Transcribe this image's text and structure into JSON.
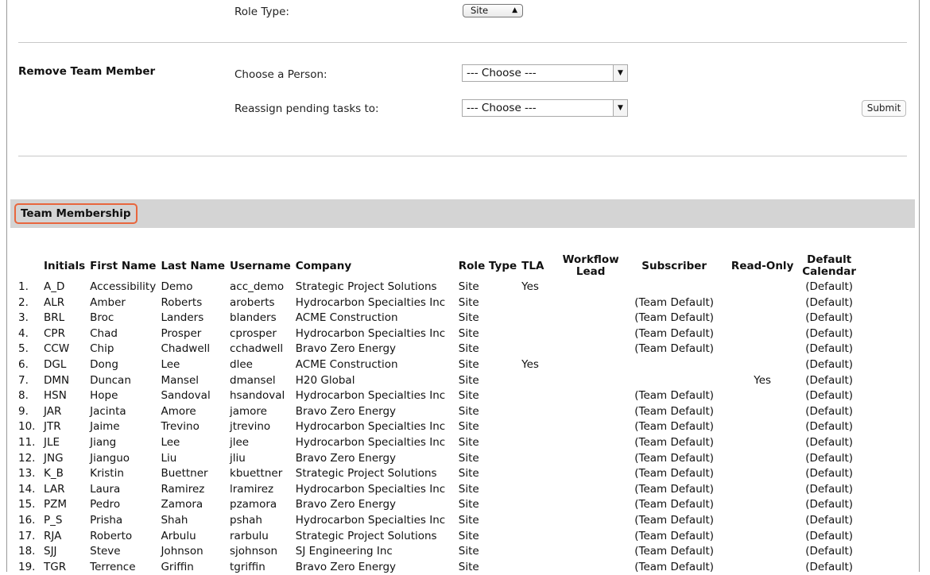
{
  "role_type": {
    "label": "Role Type:",
    "selected": "Site"
  },
  "remove_member": {
    "title": "Remove Team Member",
    "person_label": "Choose a Person:",
    "person_value": "--- Choose ---",
    "reassign_label": "Reassign pending tasks to:",
    "reassign_value": "--- Choose ---",
    "submit_label": "Submit"
  },
  "membership": {
    "title": "Team Membership",
    "columns": [
      "",
      "Initials",
      "First Name",
      "Last Name",
      "Username",
      "Company",
      "Role Type",
      "TLA",
      "Workflow Lead",
      "Subscriber",
      "Read-Only",
      "Default Calendar"
    ],
    "rows": [
      [
        "1.",
        "A_D",
        "Accessibility",
        "Demo",
        "acc_demo",
        "Strategic Project Solutions",
        "Site",
        "Yes",
        "",
        "",
        "",
        "(Default)"
      ],
      [
        "2.",
        "ALR",
        "Amber",
        "Roberts",
        "aroberts",
        "Hydrocarbon Specialties Inc",
        "Site",
        "",
        "",
        "(Team Default)",
        "",
        "(Default)"
      ],
      [
        "3.",
        "BRL",
        "Broc",
        "Landers",
        "blanders",
        "ACME Construction",
        "Site",
        "",
        "",
        "(Team Default)",
        "",
        "(Default)"
      ],
      [
        "4.",
        "CPR",
        "Chad",
        "Prosper",
        "cprosper",
        "Hydrocarbon Specialties Inc",
        "Site",
        "",
        "",
        "(Team Default)",
        "",
        "(Default)"
      ],
      [
        "5.",
        "CCW",
        "Chip",
        "Chadwell",
        "cchadwell",
        "Bravo Zero Energy",
        "Site",
        "",
        "",
        "(Team Default)",
        "",
        "(Default)"
      ],
      [
        "6.",
        "DGL",
        "Dong",
        "Lee",
        "dlee",
        "ACME Construction",
        "Site",
        "Yes",
        "",
        "",
        "",
        "(Default)"
      ],
      [
        "7.",
        "DMN",
        "Duncan",
        "Mansel",
        "dmansel",
        "H20 Global",
        "Site",
        "",
        "",
        "",
        "Yes",
        "(Default)"
      ],
      [
        "8.",
        "HSN",
        "Hope",
        "Sandoval",
        "hsandoval",
        "Hydrocarbon Specialties Inc",
        "Site",
        "",
        "",
        "(Team Default)",
        "",
        "(Default)"
      ],
      [
        "9.",
        "JAR",
        "Jacinta",
        "Amore",
        "jamore",
        "Bravo Zero Energy",
        "Site",
        "",
        "",
        "(Team Default)",
        "",
        "(Default)"
      ],
      [
        "10.",
        "JTR",
        "Jaime",
        "Trevino",
        "jtrevino",
        "Hydrocarbon Specialties Inc",
        "Site",
        "",
        "",
        "(Team Default)",
        "",
        "(Default)"
      ],
      [
        "11.",
        "JLE",
        "Jiang",
        "Lee",
        "jlee",
        "Hydrocarbon Specialties Inc",
        "Site",
        "",
        "",
        "(Team Default)",
        "",
        "(Default)"
      ],
      [
        "12.",
        "JNG",
        "Jianguo",
        "Liu",
        "jliu",
        "Bravo Zero Energy",
        "Site",
        "",
        "",
        "(Team Default)",
        "",
        "(Default)"
      ],
      [
        "13.",
        "K_B",
        "Kristin",
        "Buettner",
        "kbuettner",
        "Strategic Project Solutions",
        "Site",
        "",
        "",
        "(Team Default)",
        "",
        "(Default)"
      ],
      [
        "14.",
        "LAR",
        "Laura",
        "Ramirez",
        "lramirez",
        "Hydrocarbon Specialties Inc",
        "Site",
        "",
        "",
        "(Team Default)",
        "",
        "(Default)"
      ],
      [
        "15.",
        "PZM",
        "Pedro",
        "Zamora",
        "pzamora",
        "Bravo Zero Energy",
        "Site",
        "",
        "",
        "(Team Default)",
        "",
        "(Default)"
      ],
      [
        "16.",
        "P_S",
        "Prisha",
        "Shah",
        "pshah",
        "Hydrocarbon Specialties Inc",
        "Site",
        "",
        "",
        "(Team Default)",
        "",
        "(Default)"
      ],
      [
        "17.",
        "RJA",
        "Roberto",
        "Arbulu",
        "rarbulu",
        "Strategic Project Solutions",
        "Site",
        "",
        "",
        "(Team Default)",
        "",
        "(Default)"
      ],
      [
        "18.",
        "SJJ",
        "Steve",
        "Johnson",
        "sjohnson",
        "SJ Engineering Inc",
        "Site",
        "",
        "",
        "(Team Default)",
        "",
        "(Default)"
      ],
      [
        "19.",
        "TGR",
        "Terrence",
        "Griffin",
        "tgriffin",
        "Bravo Zero Energy",
        "Site",
        "",
        "",
        "(Team Default)",
        "",
        "(Default)"
      ]
    ]
  },
  "colors": {
    "highlight": "#e8663d",
    "section_bar": "#d4d4d4"
  }
}
